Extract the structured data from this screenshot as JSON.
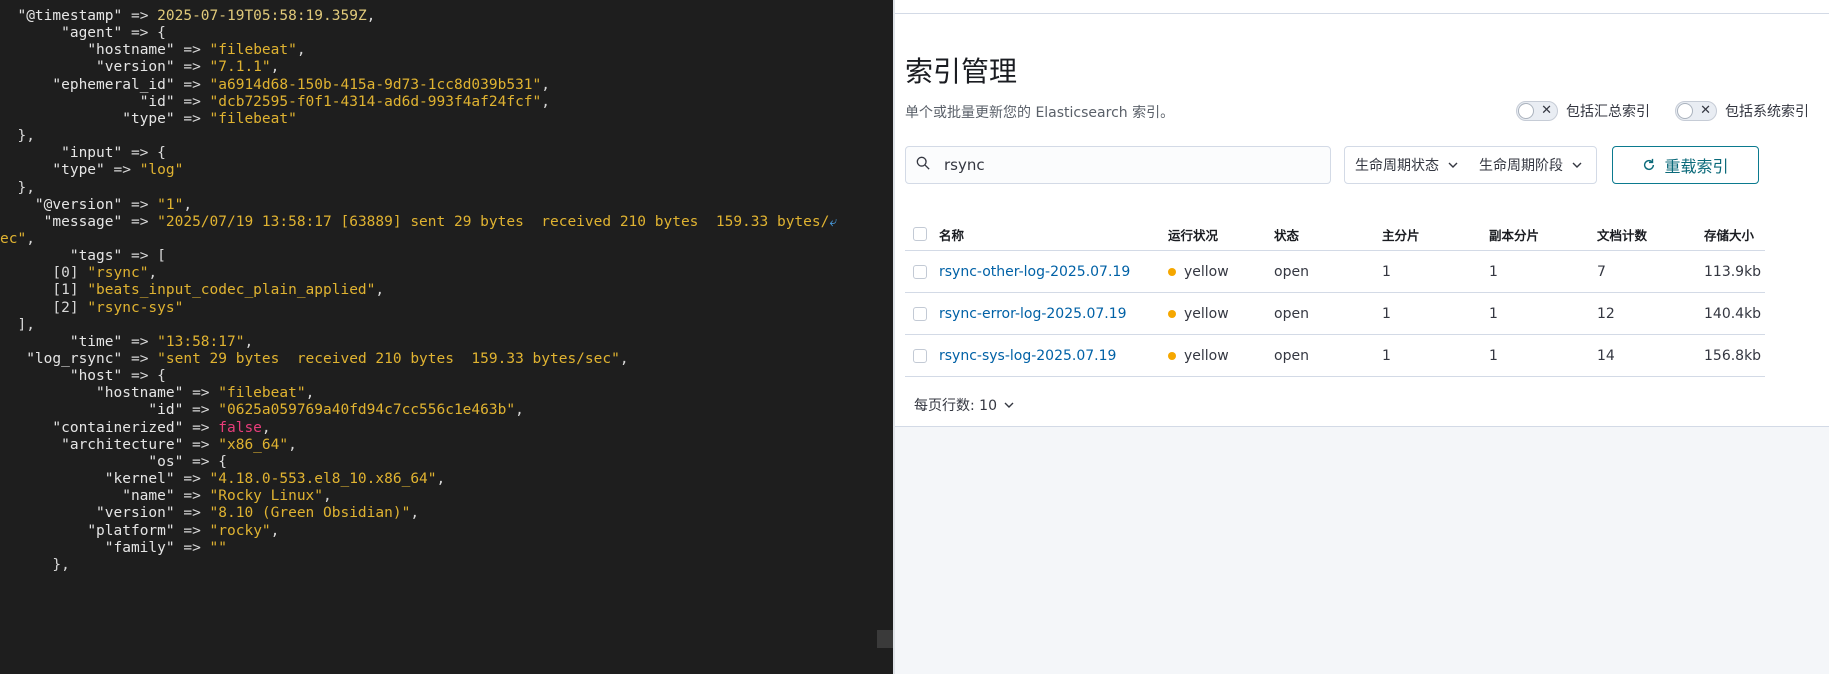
{
  "terminal": {
    "lines": [
      {
        "i": "  ",
        "t": [
          [
            "k",
            "\"@timestamp\""
          ],
          [
            "o",
            " => "
          ],
          [
            "n",
            "2025-07-19T05:58:19.359Z"
          ],
          [
            "o",
            ","
          ]
        ]
      },
      {
        "i": "       ",
        "t": [
          [
            "k",
            "\"agent\""
          ],
          [
            "o",
            " => {"
          ]
        ]
      },
      {
        "i": "          ",
        "t": [
          [
            "k",
            "\"hostname\""
          ],
          [
            "o",
            " => "
          ],
          [
            "s",
            "\"filebeat\""
          ],
          [
            "o",
            ","
          ]
        ]
      },
      {
        "i": "           ",
        "t": [
          [
            "k",
            "\"version\""
          ],
          [
            "o",
            " => "
          ],
          [
            "s",
            "\"7.1.1\""
          ],
          [
            "o",
            ","
          ]
        ]
      },
      {
        "i": "      ",
        "t": [
          [
            "k",
            "\"ephemeral_id\""
          ],
          [
            "o",
            " => "
          ],
          [
            "s",
            "\"a6914d68-150b-415a-9d73-1cc8d039b531\""
          ],
          [
            "o",
            ","
          ]
        ]
      },
      {
        "i": "                ",
        "t": [
          [
            "k",
            "\"id\""
          ],
          [
            "o",
            " => "
          ],
          [
            "s",
            "\"dcb72595-f0f1-4314-ad6d-993f4af24fcf\""
          ],
          [
            "o",
            ","
          ]
        ]
      },
      {
        "i": "              ",
        "t": [
          [
            "k",
            "\"type\""
          ],
          [
            "o",
            " => "
          ],
          [
            "s",
            "\"filebeat\""
          ]
        ]
      },
      {
        "i": "  ",
        "t": [
          [
            "o",
            "},"
          ]
        ]
      },
      {
        "i": "       ",
        "t": [
          [
            "k",
            "\"input\""
          ],
          [
            "o",
            " => {"
          ]
        ]
      },
      {
        "i": "      ",
        "t": [
          [
            "k",
            "\"type\""
          ],
          [
            "o",
            " => "
          ],
          [
            "s",
            "\"log\""
          ]
        ]
      },
      {
        "i": "  ",
        "t": [
          [
            "o",
            "},"
          ]
        ]
      },
      {
        "i": "    ",
        "t": [
          [
            "k",
            "\"@version\""
          ],
          [
            "o",
            " => "
          ],
          [
            "s",
            "\"1\""
          ],
          [
            "o",
            ","
          ]
        ]
      },
      {
        "i": "     ",
        "t": [
          [
            "k",
            "\"message\""
          ],
          [
            "o",
            " => "
          ],
          [
            "s",
            "\"2025/07/19 13:58:17 [63889] sent 29 bytes  received 210 bytes  159.33 bytes/"
          ],
          [
            "w",
            "⤶"
          ]
        ]
      },
      {
        "i": "",
        "t": [
          [
            "s",
            "ec\""
          ],
          [
            "o",
            ","
          ]
        ]
      },
      {
        "i": "        ",
        "t": [
          [
            "k",
            "\"tags\""
          ],
          [
            "o",
            " => ["
          ]
        ]
      },
      {
        "i": "      ",
        "t": [
          [
            "o",
            "[0] "
          ],
          [
            "s",
            "\"rsync\""
          ],
          [
            "o",
            ","
          ]
        ]
      },
      {
        "i": "      ",
        "t": [
          [
            "o",
            "[1] "
          ],
          [
            "s",
            "\"beats_input_codec_plain_applied\""
          ],
          [
            "o",
            ","
          ]
        ]
      },
      {
        "i": "      ",
        "t": [
          [
            "o",
            "[2] "
          ],
          [
            "s",
            "\"rsync-sys\""
          ]
        ]
      },
      {
        "i": "  ",
        "t": [
          [
            "o",
            "],"
          ]
        ]
      },
      {
        "i": "        ",
        "t": [
          [
            "k",
            "\"time\""
          ],
          [
            "o",
            " => "
          ],
          [
            "s",
            "\"13:58:17\""
          ],
          [
            "o",
            ","
          ]
        ]
      },
      {
        "i": "   ",
        "t": [
          [
            "k",
            "\"log_rsync\""
          ],
          [
            "o",
            " => "
          ],
          [
            "s",
            "\"sent 29 bytes  received 210 bytes  159.33 bytes/sec\""
          ],
          [
            "o",
            ","
          ]
        ]
      },
      {
        "i": "        ",
        "t": [
          [
            "k",
            "\"host\""
          ],
          [
            "o",
            " => {"
          ]
        ]
      },
      {
        "i": "           ",
        "t": [
          [
            "k",
            "\"hostname\""
          ],
          [
            "o",
            " => "
          ],
          [
            "s",
            "\"filebeat\""
          ],
          [
            "o",
            ","
          ]
        ]
      },
      {
        "i": "                 ",
        "t": [
          [
            "k",
            "\"id\""
          ],
          [
            "o",
            " => "
          ],
          [
            "s",
            "\"0625a059769a40fd94c7cc556c1e463b\""
          ],
          [
            "o",
            ","
          ]
        ]
      },
      {
        "i": "      ",
        "t": [
          [
            "k",
            "\"containerized\""
          ],
          [
            "o",
            " => "
          ],
          [
            "b",
            "false"
          ],
          [
            "o",
            ","
          ]
        ]
      },
      {
        "i": "       ",
        "t": [
          [
            "k",
            "\"architecture\""
          ],
          [
            "o",
            " => "
          ],
          [
            "s",
            "\"x86_64\""
          ],
          [
            "o",
            ","
          ]
        ]
      },
      {
        "i": "                 ",
        "t": [
          [
            "k",
            "\"os\""
          ],
          [
            "o",
            " => {"
          ]
        ]
      },
      {
        "i": "            ",
        "t": [
          [
            "k",
            "\"kernel\""
          ],
          [
            "o",
            " => "
          ],
          [
            "s",
            "\"4.18.0-553.el8_10.x86_64\""
          ],
          [
            "o",
            ","
          ]
        ]
      },
      {
        "i": "              ",
        "t": [
          [
            "k",
            "\"name\""
          ],
          [
            "o",
            " => "
          ],
          [
            "s",
            "\"Rocky Linux\""
          ],
          [
            "o",
            ","
          ]
        ]
      },
      {
        "i": "           ",
        "t": [
          [
            "k",
            "\"version\""
          ],
          [
            "o",
            " => "
          ],
          [
            "s",
            "\"8.10 (Green Obsidian)\""
          ],
          [
            "o",
            ","
          ]
        ]
      },
      {
        "i": "          ",
        "t": [
          [
            "k",
            "\"platform\""
          ],
          [
            "o",
            " => "
          ],
          [
            "s",
            "\"rocky\""
          ],
          [
            "o",
            ","
          ]
        ]
      },
      {
        "i": "            ",
        "t": [
          [
            "k",
            "\"family\""
          ],
          [
            "o",
            " => "
          ],
          [
            "s",
            "\"\""
          ]
        ]
      },
      {
        "i": "      ",
        "t": [
          [
            "o",
            "},"
          ]
        ]
      }
    ]
  },
  "kibana": {
    "title": "索引管理",
    "description": "单个或批量更新您的 Elasticsearch 索引。",
    "toggles": {
      "rollup_label": "包括汇总索引",
      "system_label": "包括系统索引",
      "off_glyph": "✕"
    },
    "search": {
      "value": "rsync"
    },
    "filters": {
      "lifecycle_status": "生命周期状态",
      "lifecycle_phase": "生命周期阶段"
    },
    "reload_label": "重载索引",
    "table": {
      "headers": {
        "name": "名称",
        "health": "运行状况",
        "status": "状态",
        "primary": "主分片",
        "replicas": "副本分片",
        "docs": "文档计数",
        "size": "存储大小"
      },
      "rows": [
        {
          "name": "rsync-other-log-2025.07.19",
          "health": "yellow",
          "status": "open",
          "primary": "1",
          "replicas": "1",
          "docs": "7",
          "size": "113.9kb"
        },
        {
          "name": "rsync-error-log-2025.07.19",
          "health": "yellow",
          "status": "open",
          "primary": "1",
          "replicas": "1",
          "docs": "12",
          "size": "140.4kb"
        },
        {
          "name": "rsync-sys-log-2025.07.19",
          "health": "yellow",
          "status": "open",
          "primary": "1",
          "replicas": "1",
          "docs": "14",
          "size": "156.8kb"
        }
      ]
    },
    "rows_per_page": "每页行数: 10"
  }
}
